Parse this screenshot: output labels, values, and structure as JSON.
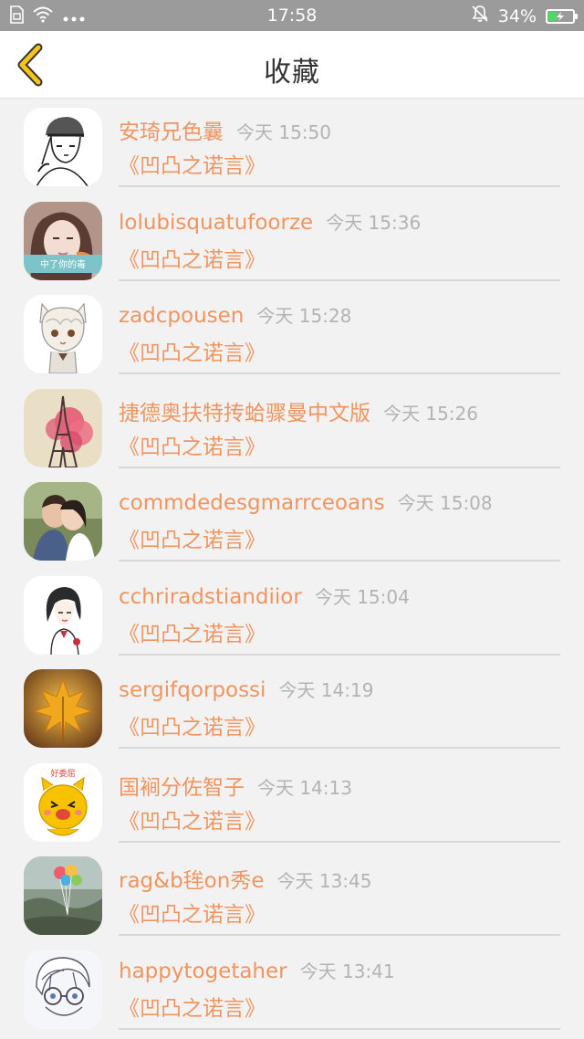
{
  "status_bar": {
    "time": "17:58",
    "battery_percent": "34%",
    "battery_level": 0.34,
    "icons": [
      "sim-icon",
      "wifi-icon",
      "more-dots-icon",
      "silent-bell-icon",
      "battery-icon"
    ]
  },
  "header": {
    "title": "收藏",
    "back_icon": "chevron-left-icon",
    "accent_color": "#f5c518"
  },
  "colors": {
    "name": "#f0955f",
    "time": "#b3b3b3",
    "background": "#f2f2f2"
  },
  "items": [
    {
      "username": "安琦兄色曩",
      "time": "今天 15:50",
      "book_title": "《凹凸之诺言》",
      "avatar": "sketch-boy-beanie"
    },
    {
      "username": "lolubisquatufoorze",
      "time": "今天 15:36",
      "book_title": "《凹凸之诺言》",
      "avatar": "girl-photo-caption"
    },
    {
      "username": "zadcpousen",
      "time": "今天 15:28",
      "book_title": "《凹凸之诺言》",
      "avatar": "anime-cat-boy"
    },
    {
      "username": "捷德奥扶特抟蛤骤曼中文版",
      "time": "今天 15:26",
      "book_title": "《凹凸之诺言》",
      "avatar": "eiffel-tower-blossom"
    },
    {
      "username": "commdedesgmarrceoans",
      "time": "今天 15:08",
      "book_title": "《凹凸之诺言》",
      "avatar": "couple-kissing"
    },
    {
      "username": "cchriradstiandiior",
      "time": "今天 15:04",
      "book_title": "《凹凸之诺言》",
      "avatar": "sketch-girl"
    },
    {
      "username": "sergifqorpossi",
      "time": "今天 14:19",
      "book_title": "《凹凸之诺言》",
      "avatar": "maple-leaf"
    },
    {
      "username": "国裥分佐智子",
      "time": "今天 14:13",
      "book_title": "《凹凸之诺言》",
      "avatar": "cartoon-hamster"
    },
    {
      "username": "rag&b毪on秀e",
      "time": "今天 13:45",
      "book_title": "《凹凸之诺言》",
      "avatar": "balloons-landscape"
    },
    {
      "username": "happytogetaher",
      "time": "今天 13:41",
      "book_title": "《凹凸之诺言》",
      "avatar": "manga-boy-glasses"
    }
  ]
}
